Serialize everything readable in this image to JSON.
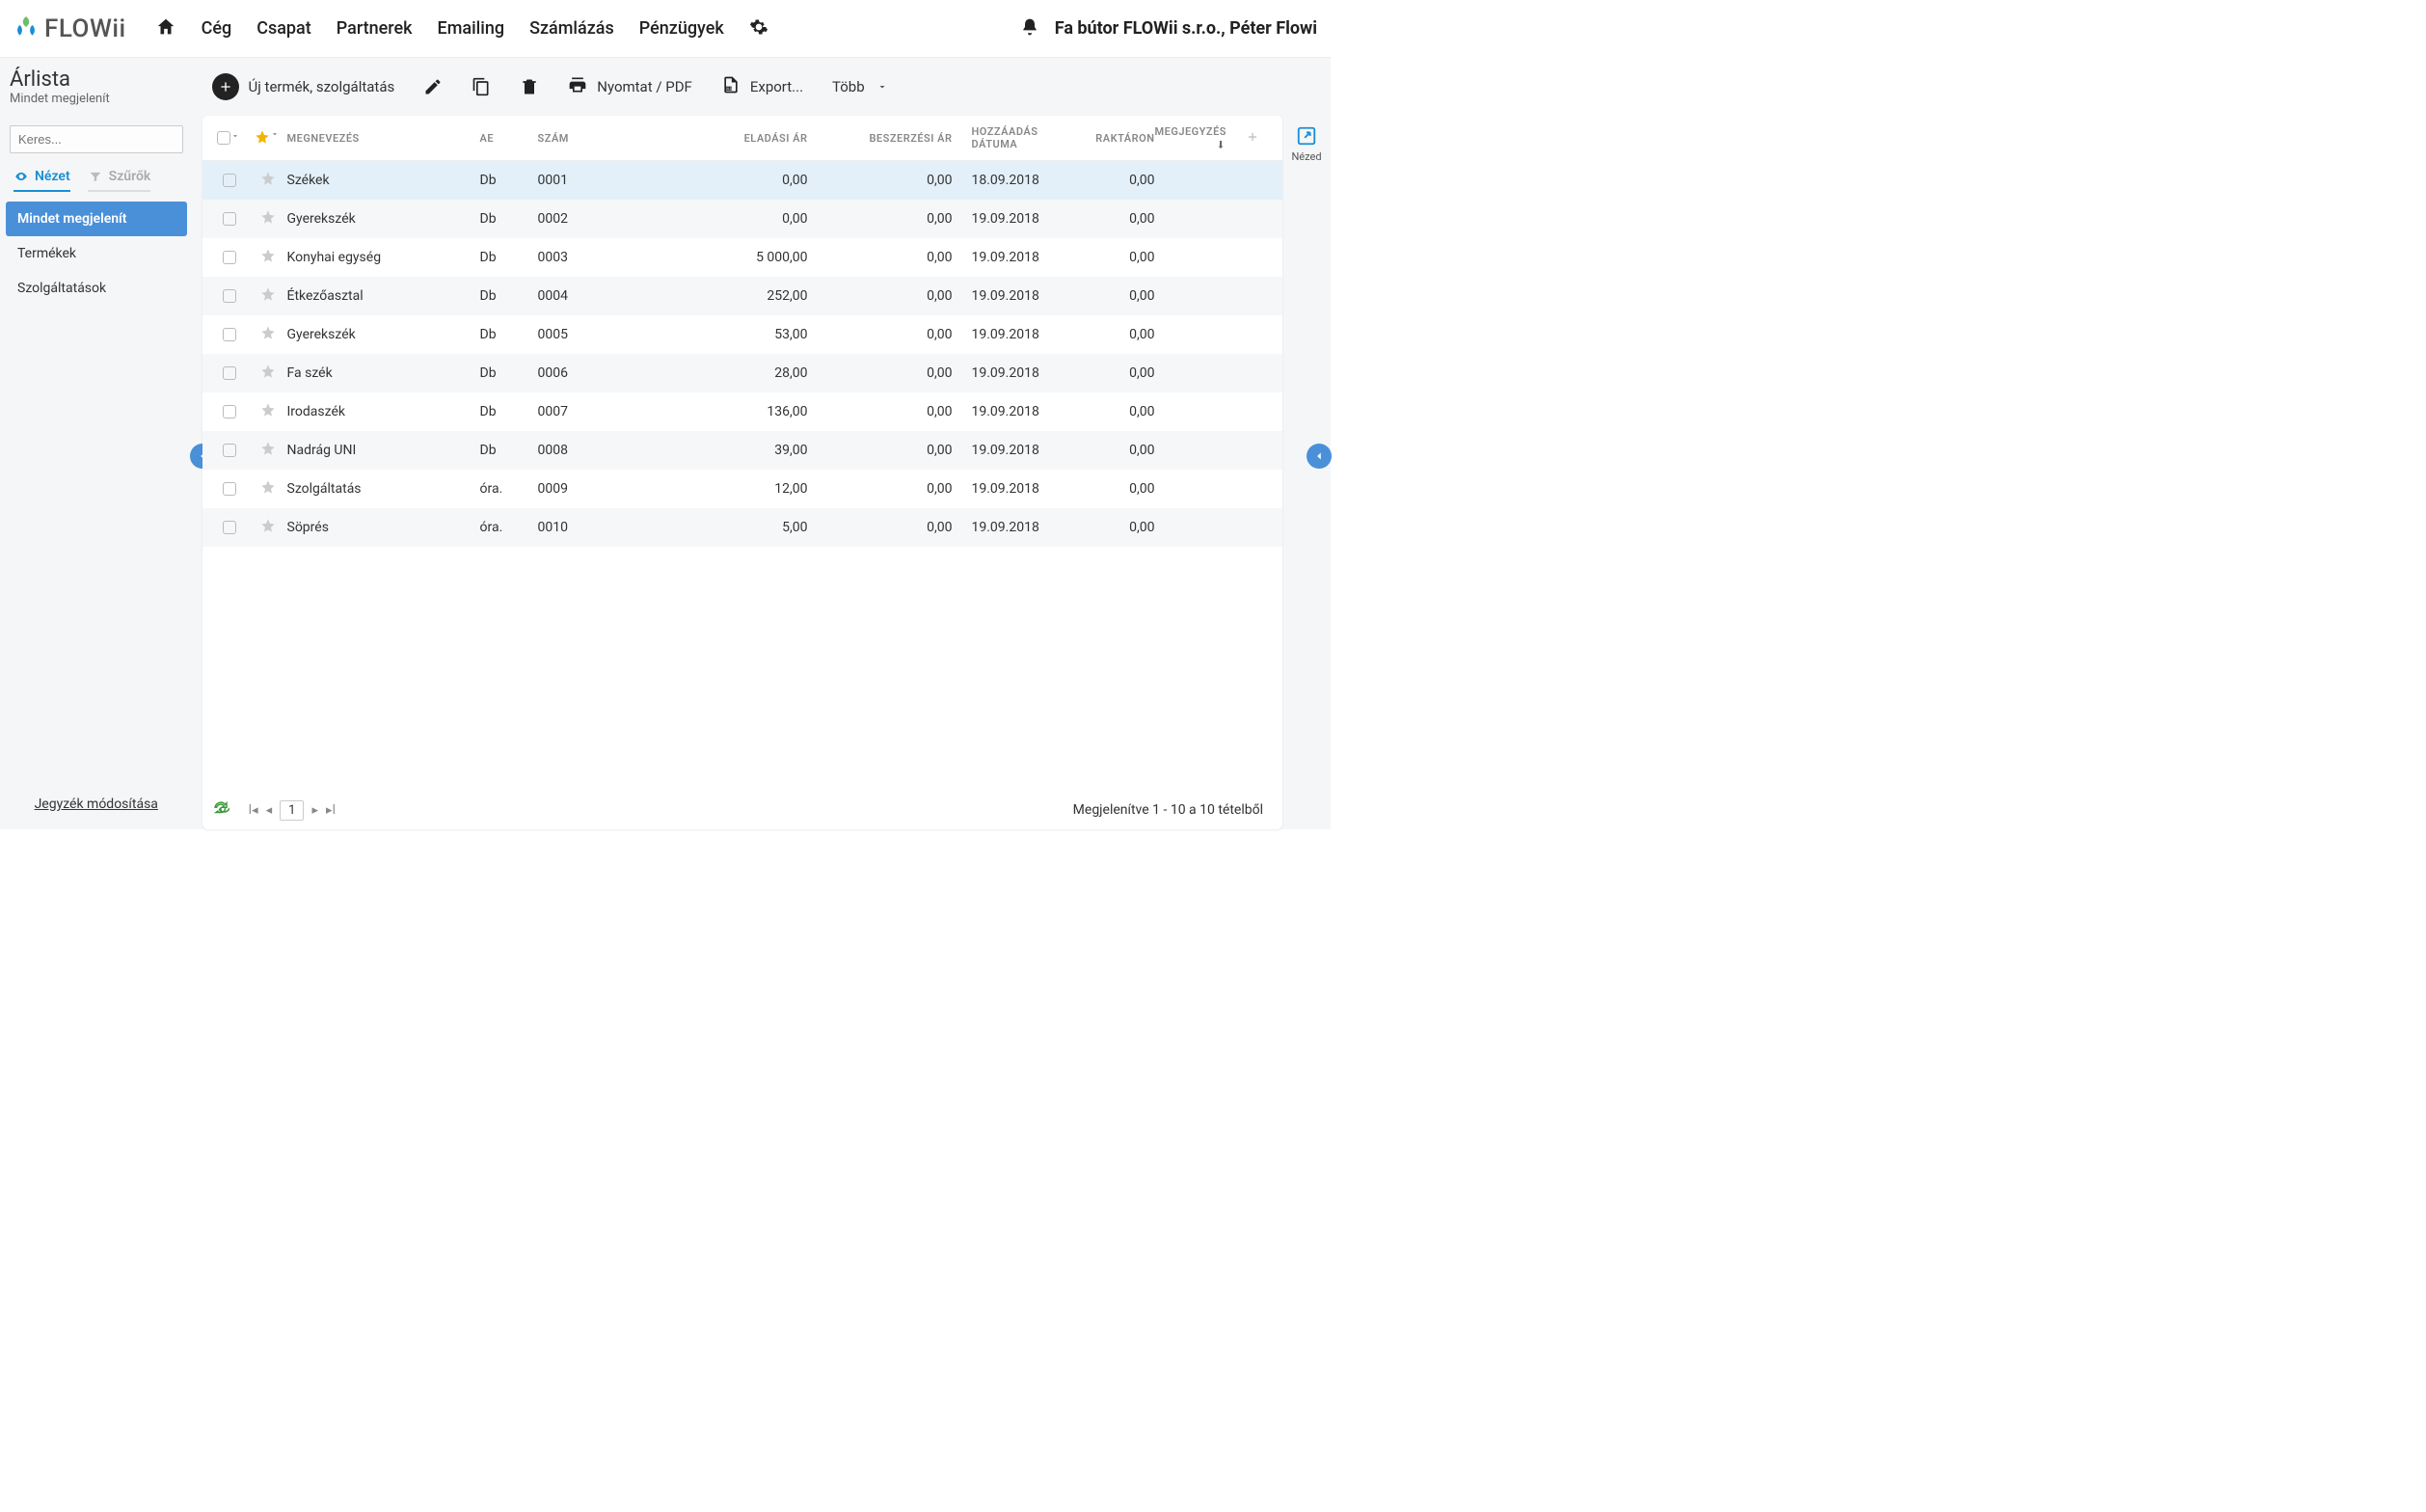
{
  "brand": {
    "name": "FLOWii"
  },
  "nav": {
    "items": [
      "Cég",
      "Csapat",
      "Partnerek",
      "Emailing",
      "Számlázás",
      "Pénzügyek"
    ]
  },
  "account": {
    "company": "Fa bútor FLOWii s.r.o., Péter Flowi"
  },
  "side": {
    "title": "Árlista",
    "subtitle": "Mindet megjelenít",
    "search_placeholder": "Keres...",
    "tab_view": "Nézet",
    "tab_filter": "Szűrők",
    "items": [
      "Mindet megjelenít",
      "Termékek",
      "Szolgáltatások"
    ],
    "modify_link": "Jegyzék módosítása"
  },
  "toolbar": {
    "new_label": "Új termék, szolgáltatás",
    "print_label": "Nyomtat / PDF",
    "export_label": "Export...",
    "more_label": "Több"
  },
  "columns": {
    "name": "MEGNEVEZÉS",
    "ae": "AE",
    "num": "SZÁM",
    "sell": "ELADÁSI ÁR",
    "buy": "BESZERZÉSI ÁR",
    "date": "HOZZÁADÁS DÁTUMA",
    "stock": "RAKTÁRON",
    "note": "MEGJEGYZÉS"
  },
  "rows": [
    {
      "name": "Székek",
      "ae": "Db",
      "num": "0001",
      "sell": "0,00",
      "buy": "0,00",
      "date": "18.09.2018",
      "stock": "0,00"
    },
    {
      "name": "Gyerekszék",
      "ae": "Db",
      "num": "0002",
      "sell": "0,00",
      "buy": "0,00",
      "date": "19.09.2018",
      "stock": "0,00"
    },
    {
      "name": "Konyhai egység",
      "ae": "Db",
      "num": "0003",
      "sell": "5 000,00",
      "buy": "0,00",
      "date": "19.09.2018",
      "stock": "0,00"
    },
    {
      "name": "Étkezőasztal",
      "ae": "Db",
      "num": "0004",
      "sell": "252,00",
      "buy": "0,00",
      "date": "19.09.2018",
      "stock": "0,00"
    },
    {
      "name": "Gyerekszék",
      "ae": "Db",
      "num": "0005",
      "sell": "53,00",
      "buy": "0,00",
      "date": "19.09.2018",
      "stock": "0,00"
    },
    {
      "name": "Fa szék",
      "ae": "Db",
      "num": "0006",
      "sell": "28,00",
      "buy": "0,00",
      "date": "19.09.2018",
      "stock": "0,00"
    },
    {
      "name": "Irodaszék",
      "ae": "Db",
      "num": "0007",
      "sell": "136,00",
      "buy": "0,00",
      "date": "19.09.2018",
      "stock": "0,00"
    },
    {
      "name": "Nadrág UNI",
      "ae": "Db",
      "num": "0008",
      "sell": "39,00",
      "buy": "0,00",
      "date": "19.09.2018",
      "stock": "0,00"
    },
    {
      "name": "Szolgáltatás",
      "ae": "óra.",
      "num": "0009",
      "sell": "12,00",
      "buy": "0,00",
      "date": "19.09.2018",
      "stock": "0,00"
    },
    {
      "name": "Söprés",
      "ae": "óra.",
      "num": "0010",
      "sell": "5,00",
      "buy": "0,00",
      "date": "19.09.2018",
      "stock": "0,00"
    }
  ],
  "rail": {
    "view_label": "Nézed"
  },
  "pager": {
    "page": "1"
  },
  "footer": {
    "status": "Megjelenítve 1 - 10 a 10 tételből"
  }
}
